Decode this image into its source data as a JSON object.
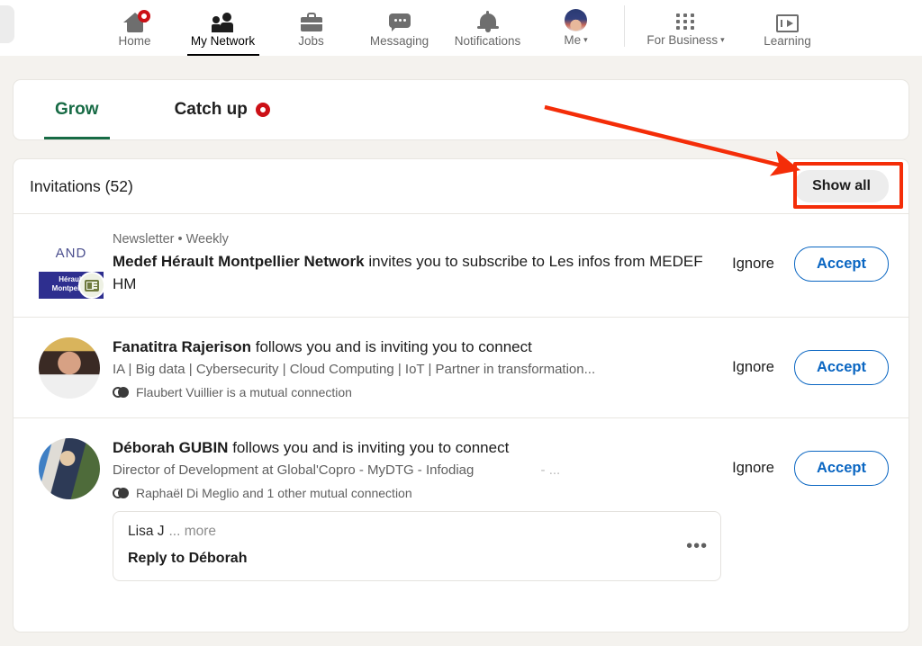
{
  "nav": {
    "items": [
      {
        "label": "Home",
        "icon": "home-icon",
        "badge": true,
        "active": false
      },
      {
        "label": "My Network",
        "icon": "network-icon",
        "badge": false,
        "active": true
      },
      {
        "label": "Jobs",
        "icon": "briefcase-icon",
        "badge": false,
        "active": false
      },
      {
        "label": "Messaging",
        "icon": "message-icon",
        "badge": false,
        "active": false
      },
      {
        "label": "Notifications",
        "icon": "bell-icon",
        "badge": false,
        "active": false
      },
      {
        "label": "Me",
        "icon": "avatar-icon",
        "caret": "▾",
        "active": false
      },
      {
        "label": "For Business",
        "icon": "grid-icon",
        "caret": "▾",
        "active": false
      },
      {
        "label": "Learning",
        "icon": "learning-icon",
        "active": false
      }
    ]
  },
  "tabs": {
    "grow": "Grow",
    "catch_up": "Catch up",
    "catch_up_badge": true,
    "active_color": "#176b45"
  },
  "invitations": {
    "title": "Invitations (52)",
    "show_all": "Show all",
    "items": [
      {
        "type": "newsletter",
        "avatar_top_text": "AND",
        "avatar_bottom_text": "Hérault Montpellier",
        "avatar_badge_icon": "newsletter-icon",
        "sub_line": "Newsletter • Weekly",
        "name": "Medef Hérault Montpellier Network",
        "message": " invites you to subscribe to Les infos from MEDEF HM",
        "ignore": "Ignore",
        "accept": "Accept"
      },
      {
        "type": "person",
        "avatar_icon": "profile-photo",
        "name": "Fanatitra Rajerison",
        "message": " follows you and is inviting you to connect",
        "headline": "IA | Big data | Cybersecurity |  Cloud Computing | IoT | Partner in transformation...",
        "mutual_icon": "mutual-connections-icon",
        "mutual": "Flaubert Vuillier is a mutual connection",
        "ignore": "Ignore",
        "accept": "Accept"
      },
      {
        "type": "person",
        "avatar_icon": "profile-photo",
        "name": "Déborah GUBIN",
        "message": " follows you and is inviting you to connect",
        "headline": "Director of Development at Global'Copro - MyDTG - Infodiag",
        "headline_suffix": "- ...",
        "mutual_icon": "mutual-connections-icon",
        "mutual": "Raphaël Di Meglio and 1 other mutual connection",
        "ignore": "Ignore",
        "accept": "Accept",
        "reply": {
          "author": "Lisa J",
          "more": "... more",
          "prompt": "Reply to Déborah",
          "menu": "•••"
        }
      }
    ]
  },
  "annotation": {
    "highlight_color": "#f42d08",
    "target": "show-all-button"
  }
}
